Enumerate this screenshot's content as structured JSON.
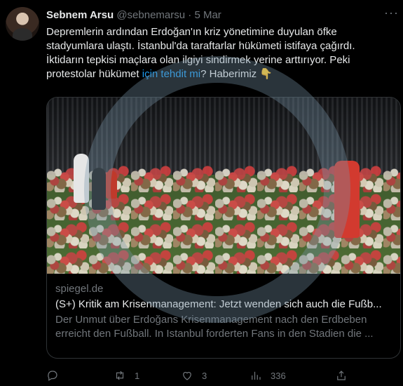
{
  "tweet": {
    "author_name": "Sebnem Arsu",
    "handle": "@sebnemarsu",
    "separator": "·",
    "date": "5 Mar",
    "more_label": "···",
    "text_part1": "Depremlerin ardından Erdoğan'ın kriz yönetimine duyulan öfke stadyumlara ulaştı. İstanbul'da taraftarlar hükümeti istifaya çağırdı. İktidarın tepkisi maçlara olan ilgiyi sindirmek yerine arttırıyor. Peki protestolar hükümet",
    "text_link": " için tehdit mi",
    "text_part2": "? Haberimiz 👇"
  },
  "card": {
    "domain": "spiegel.de",
    "title": "(S+) Kritik am Krisenmanagement: Jetzt wenden sich auch die Fußb...",
    "description": "Der Unmut über Erdoğans Krisenmanagement nach den Erdbeben erreicht den Fußball. In Istanbul forderten Fans in den Stadien die ..."
  },
  "actions": {
    "reply_icon": "reply-icon",
    "reply_count": "",
    "retweet_icon": "retweet-icon",
    "retweet_count": "1",
    "like_icon": "heart-icon",
    "like_count": "3",
    "views_icon": "views-icon",
    "views_count": "336",
    "share_icon": "share-icon"
  },
  "colors": {
    "background": "#000000",
    "text": "#e7e9ea",
    "muted": "#71767b",
    "link": "#1d9bf0",
    "border": "#2f3336"
  }
}
